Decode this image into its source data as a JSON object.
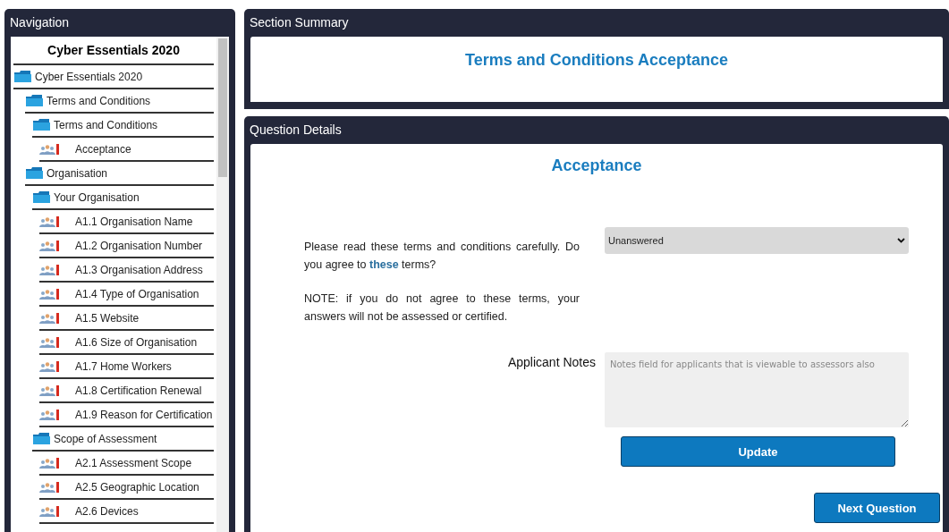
{
  "navigation": {
    "title": "Navigation",
    "tree_title": "Cyber Essentials 2020",
    "tree": [
      {
        "label": "Cyber Essentials 2020",
        "kind": "folder",
        "children": [
          {
            "label": "Terms and Conditions",
            "kind": "folder",
            "children": [
              {
                "label": "Terms and Conditions",
                "kind": "folder",
                "children": [
                  {
                    "label": "Acceptance",
                    "kind": "question"
                  }
                ]
              }
            ]
          },
          {
            "label": "Organisation",
            "kind": "folder",
            "children": [
              {
                "label": "Your Organisation",
                "kind": "folder",
                "children": [
                  {
                    "label": "A1.1 Organisation Name",
                    "kind": "question"
                  },
                  {
                    "label": "A1.2 Organisation Number",
                    "kind": "question"
                  },
                  {
                    "label": "A1.3 Organisation Address",
                    "kind": "question"
                  },
                  {
                    "label": "A1.4 Type of Organisation",
                    "kind": "question"
                  },
                  {
                    "label": "A1.5 Website",
                    "kind": "question"
                  },
                  {
                    "label": "A1.6 Size of Organisation",
                    "kind": "question"
                  },
                  {
                    "label": "A1.7 Home Workers",
                    "kind": "question"
                  },
                  {
                    "label": "A1.8 Certification Renewal",
                    "kind": "question"
                  },
                  {
                    "label": "A1.9 Reason for Certification",
                    "kind": "question"
                  }
                ]
              },
              {
                "label": "Scope of Assessment",
                "kind": "folder",
                "children": [
                  {
                    "label": "A2.1 Assessment Scope",
                    "kind": "question"
                  },
                  {
                    "label": "A2.5 Geographic Location",
                    "kind": "question"
                  },
                  {
                    "label": "A2.6 Devices",
                    "kind": "question"
                  }
                ]
              }
            ]
          }
        ]
      }
    ]
  },
  "section_summary": {
    "title": "Section Summary",
    "heading": "Terms and Conditions Acceptance"
  },
  "question_details": {
    "title": "Question Details",
    "heading": "Acceptance",
    "question_paragraphs": [
      "Please read these terms and conditions carefully. Do you agree to **these** terms?",
      "NOTE: if you do not agree to these terms, your answers will not be assessed or certified."
    ],
    "answer_select": {
      "value": "Unanswered"
    },
    "notes_label": "Applicant Notes",
    "notes_field": {
      "placeholder": "Notes field for applicants that is viewable to assessors also"
    },
    "update_button": "Update",
    "next_button": "Next Question"
  }
}
